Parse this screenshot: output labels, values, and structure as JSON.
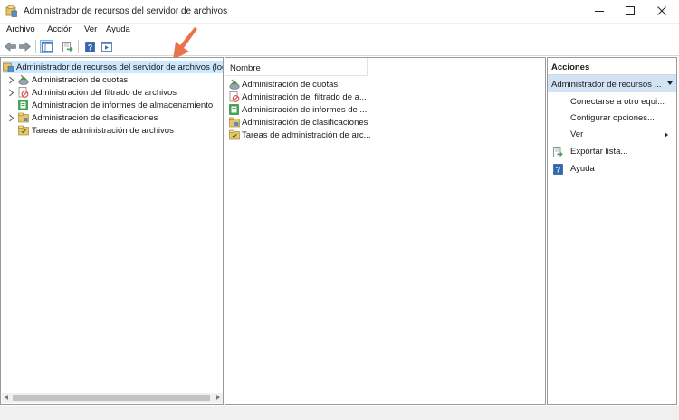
{
  "window": {
    "title": "Administrador de recursos del servidor de archivos"
  },
  "menubar": {
    "items": [
      "Archivo",
      "Acción",
      "Ver",
      "Ayuda"
    ]
  },
  "toolbar": {
    "buttons": [
      "back-icon",
      "forward-icon",
      "show-hide-console-tree-icon",
      "export-list-icon",
      "help-icon",
      "action-pane-icon"
    ]
  },
  "tree": {
    "root_label": "Administrador de recursos del servidor de archivos (local)",
    "items": [
      {
        "label": "Administración de cuotas",
        "icon": "quota-icon",
        "expandable": true
      },
      {
        "label": "Administración del filtrado de archivos",
        "icon": "file-screen-icon",
        "expandable": true
      },
      {
        "label": "Administración de informes de almacenamiento",
        "icon": "storage-report-icon",
        "expandable": false
      },
      {
        "label": "Administración de clasificaciones",
        "icon": "classification-icon",
        "expandable": true
      },
      {
        "label": "Tareas de administración de archivos",
        "icon": "file-tasks-icon",
        "expandable": false
      }
    ]
  },
  "list": {
    "column_header": "Nombre",
    "items": [
      {
        "label": "Administración de cuotas",
        "icon": "quota-icon"
      },
      {
        "label": "Administración del filtrado de a...",
        "icon": "file-screen-icon"
      },
      {
        "label": "Administración de informes de ...",
        "icon": "storage-report-icon"
      },
      {
        "label": "Administración de clasificaciones",
        "icon": "classification-icon"
      },
      {
        "label": "Tareas de administración de arc...",
        "icon": "file-tasks-icon"
      }
    ]
  },
  "actions": {
    "title": "Acciones",
    "group_label": "Administrador de recursos ...",
    "items": [
      {
        "label": "Conectarse a otro equi...",
        "icon": ""
      },
      {
        "label": "Configurar opciones...",
        "icon": ""
      },
      {
        "label": "Ver",
        "icon": "",
        "submenu": true
      },
      {
        "label": "Exportar lista...",
        "icon": "export-list-icon"
      },
      {
        "label": "Ayuda",
        "icon": "help-icon"
      }
    ]
  },
  "colors": {
    "selection": "#cce8ff",
    "actions_group": "#d2e4f4",
    "annotation_arrow": "#e8734a"
  }
}
